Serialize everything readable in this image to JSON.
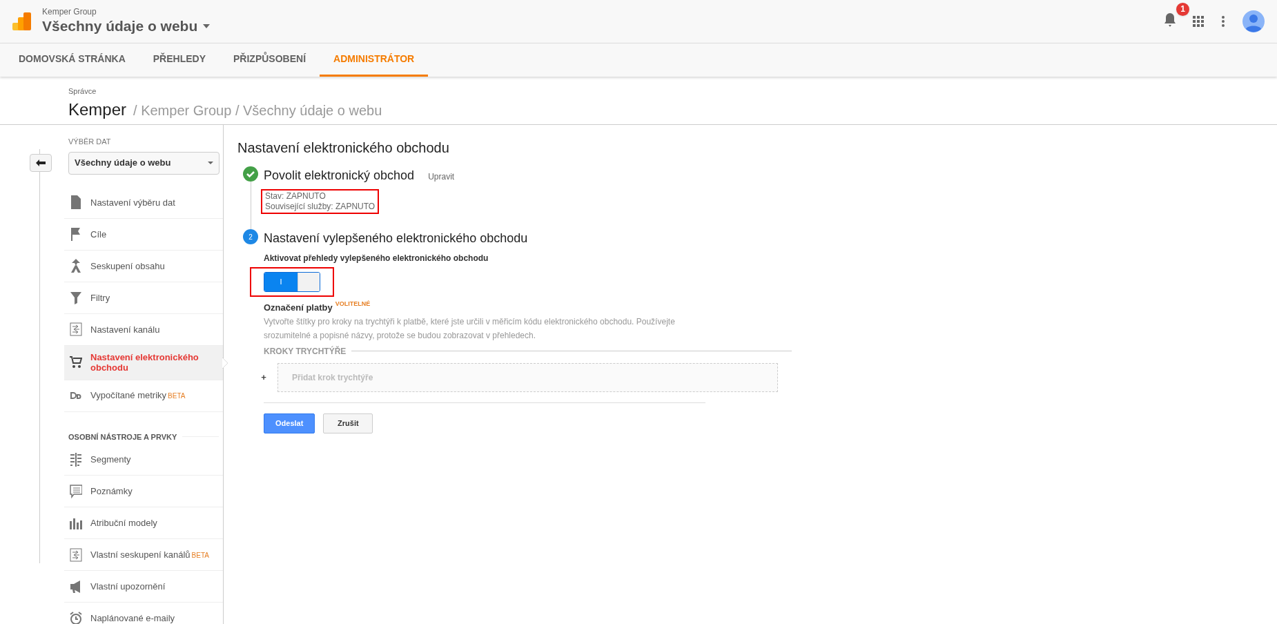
{
  "header": {
    "account": "Kemper Group",
    "view": "Všechny údaje o webu",
    "notification_count": "1"
  },
  "tabs": [
    {
      "label": "DOMOVSKÁ STRÁNKA",
      "selected": false
    },
    {
      "label": "PŘEHLEDY",
      "selected": false
    },
    {
      "label": "PŘIZPŮSOBENÍ",
      "selected": false
    },
    {
      "label": "ADMINISTRÁTOR",
      "selected": true
    }
  ],
  "breadcrumb": {
    "caption": "Správce",
    "current": "Kemper",
    "path": "/ Kemper Group / Všechny údaje o webu"
  },
  "sidebar": {
    "section_label": "VÝBĚR DAT",
    "view_select": "Všechny údaje o webu",
    "items": [
      {
        "label": "Nastavení výběru dat",
        "selected": false
      },
      {
        "label": "Cíle",
        "selected": false
      },
      {
        "label": "Seskupení obsahu",
        "selected": false
      },
      {
        "label": "Filtry",
        "selected": false
      },
      {
        "label": "Nastavení kanálu",
        "selected": false
      },
      {
        "label": "Nastavení elektronického obchodu",
        "selected": true
      },
      {
        "label": "Vypočítané metriky",
        "badge": "BETA",
        "selected": false
      }
    ],
    "personal_label": "OSOBNÍ NÁSTROJE A PRVKY",
    "personal_items": [
      {
        "label": "Segmenty",
        "selected": false
      },
      {
        "label": "Poznámky",
        "selected": false
      },
      {
        "label": "Atribuční modely",
        "selected": false
      },
      {
        "label": "Vlastní seskupení kanálů",
        "badge": "BETA",
        "selected": false
      },
      {
        "label": "Vlastní upozornění",
        "selected": false
      },
      {
        "label": "Naplánované e-maily",
        "selected": false
      }
    ]
  },
  "main": {
    "title": "Nastavení elektronického obchodu",
    "steps": [
      {
        "kind": "done",
        "title": "Povolit elektronický obchod",
        "action": "Upravit",
        "details": [
          "Stav: ZAPNUTO",
          "Související služby: ZAPNUTO"
        ],
        "highlighted": true
      },
      {
        "kind": "numbered",
        "number": "2",
        "title": "Nastavení vylepšeného elektronického obchodu"
      }
    ],
    "toggle": {
      "label": "Aktivovat přehledy vylepšeného elektronického obchodu",
      "on": true,
      "on_text": "I",
      "highlighted": true
    },
    "checkout": {
      "label": "Označení platby",
      "optional": "VOLITELNÉ",
      "description": "Vytvořte štítky pro kroky na trychtýři k platbě, které jste určili v měřicím kódu elektronického obchodu. Používejte srozumitelné a popisné názvy, protože se budou zobrazovat v přehledech.",
      "steps_label": "KROKY TRYCHTÝŘE",
      "add_symbol": "+",
      "add_placeholder": "Přidat krok trychtýře"
    },
    "buttons": [
      {
        "label": "Odeslat",
        "kind": "primary"
      },
      {
        "label": "Zrušit",
        "kind": "secondary"
      }
    ]
  }
}
